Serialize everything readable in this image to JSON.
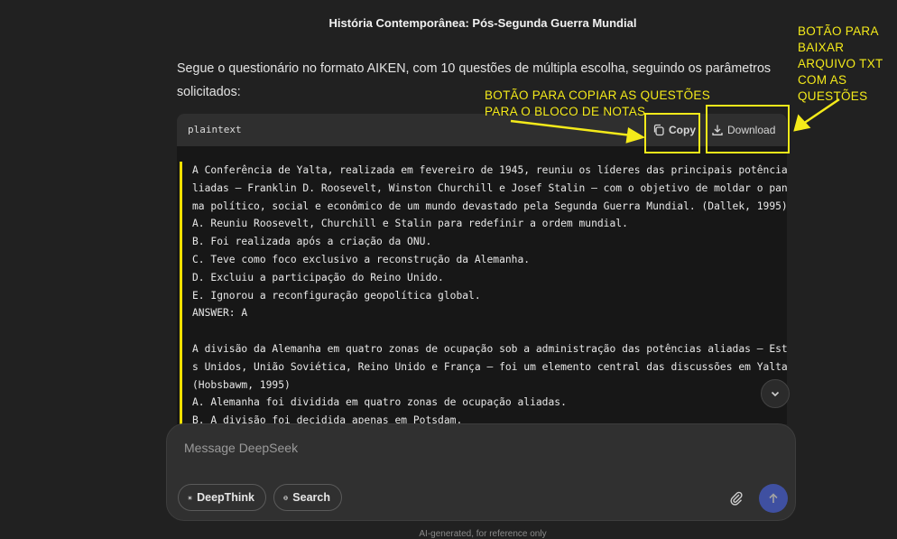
{
  "page": {
    "title": "História Contemporânea: Pós-Segunda Guerra Mundial",
    "intro": "Segue o questionário no formato AIKEN, com 10 questões de múltipla escolha, seguindo os parâmetros solicitados:"
  },
  "code_block": {
    "language": "plaintext",
    "copy_label": "Copy",
    "download_label": "Download",
    "lines": [
      "A Conferência de Yalta, realizada em fevereiro de 1945, reuniu os líderes das principais potências a",
      "liadas – Franklin D. Roosevelt, Winston Churchill e Josef Stalin – com o objetivo de moldar o panora",
      "ma político, social e econômico de um mundo devastado pela Segunda Guerra Mundial. (Dallek, 1995)",
      "A. Reuniu Roosevelt, Churchill e Stalin para redefinir a ordem mundial.",
      "B. Foi realizada após a criação da ONU.",
      "C. Teve como foco exclusivo a reconstrução da Alemanha.",
      "D. Excluiu a participação do Reino Unido.",
      "E. Ignorou a reconfiguração geopolítica global.",
      "ANSWER: A",
      "",
      "A divisão da Alemanha em quatro zonas de ocupação sob a administração das potências aliadas – Estado",
      "s Unidos, União Soviética, Reino Unido e França – foi um elemento central das discussões em Yalta.",
      "(Hobsbawm, 1995)",
      "A. Alemanha foi dividida em quatro zonas de ocupação aliadas.",
      "B. A divisão foi decidida apenas em Potsdam."
    ]
  },
  "composer": {
    "placeholder": "Message DeepSeek",
    "deepthink_label": "DeepThink",
    "search_label": "Search"
  },
  "footer": "AI-generated, for reference only",
  "annotations": {
    "copy_note": "BOTÃO PARA COPIAR AS QUESTÕES PARA O BLOCO DE NOTAS",
    "download_note": "BOTÃO PARA BAIXAR ARQUIVO TXT COM AS QUESTÕES"
  },
  "colors": {
    "background": "#212121",
    "accent": "#4d6bfe",
    "annotation": "#f4ea1a"
  }
}
